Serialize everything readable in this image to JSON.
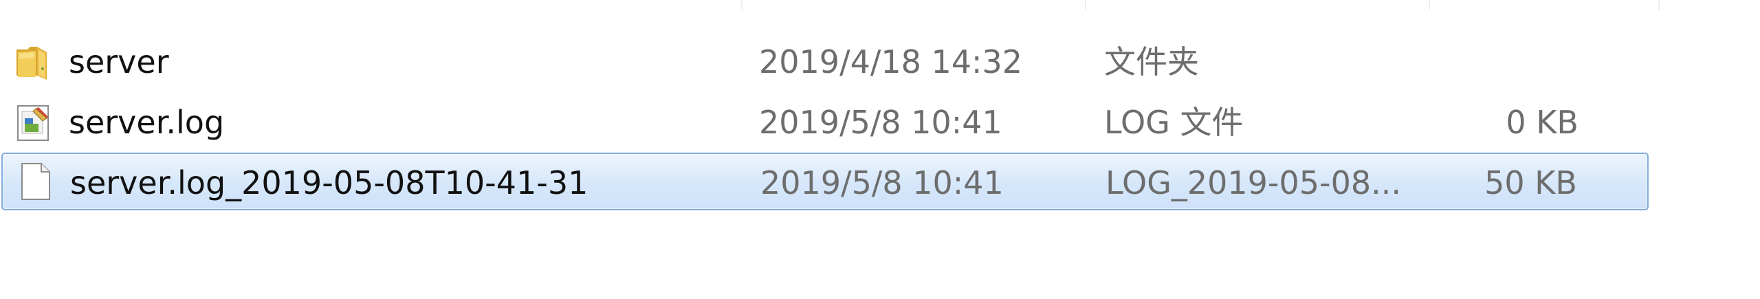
{
  "files": [
    {
      "name": "server",
      "date": "2019/4/18 14:32",
      "type": "文件夹",
      "size": "",
      "icon": "folder-icon",
      "selected": false
    },
    {
      "name": "server.log",
      "date": "2019/5/8 10:41",
      "type": "LOG 文件",
      "size": "0 KB",
      "icon": "log-file-icon",
      "selected": false
    },
    {
      "name": "server.log_2019-05-08T10-41-31",
      "date": "2019/5/8 10:41",
      "type": "LOG_2019-05-08...",
      "size": "50 KB",
      "icon": "blank-file-icon",
      "selected": true
    }
  ],
  "colors": {
    "selection_border": "#84acdd",
    "selection_fill": "#d6e7fb",
    "folder": "#e8b83a",
    "secondary_text": "#6d6d6d"
  }
}
